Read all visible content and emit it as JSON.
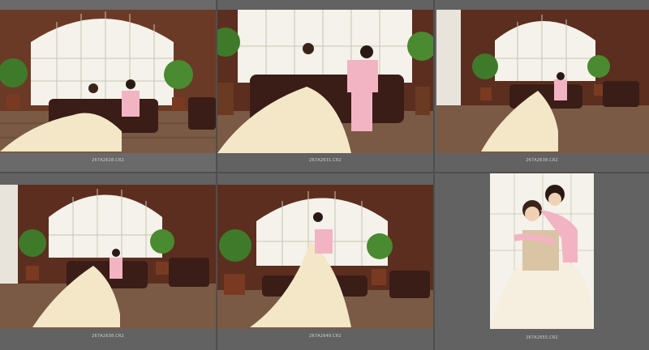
{
  "grid": {
    "thumbnails": [
      {
        "filename": "267A2628.CR2",
        "orientation": "landscape"
      },
      {
        "filename": "267A2631.CR2",
        "orientation": "landscape"
      },
      {
        "filename": "267A2638.CR2",
        "orientation": "landscape"
      },
      {
        "filename": "267A2638.CR2",
        "orientation": "landscape"
      },
      {
        "filename": "267A2649.CR2",
        "orientation": "landscape"
      },
      {
        "filename": "267A2655.CR2",
        "orientation": "portrait"
      }
    ]
  }
}
